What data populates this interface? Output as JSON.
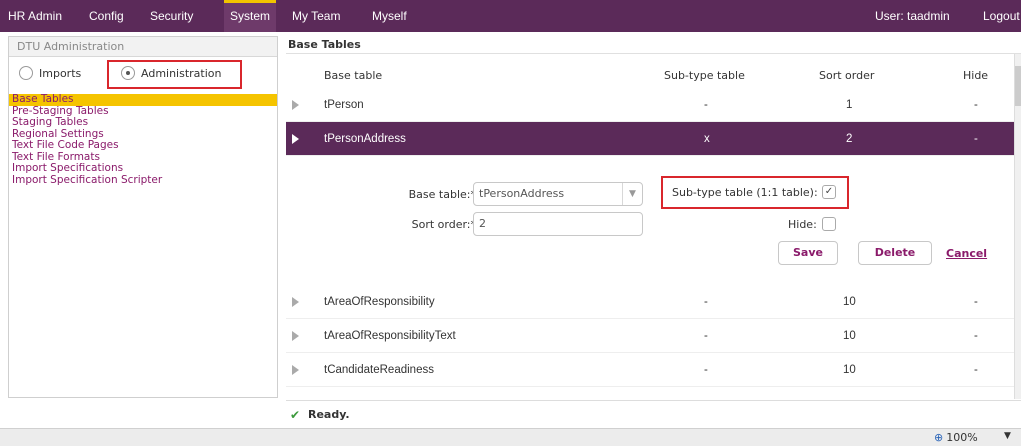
{
  "topnav": {
    "items": [
      "HR Admin",
      "Config",
      "Security",
      "System",
      "My Team",
      "Myself"
    ],
    "user": "User: taadmin",
    "logout": "Logout"
  },
  "left": {
    "panel_title": "DTU Administration",
    "radio_imports": "Imports",
    "radio_admin": "Administration",
    "menu": [
      "Base Tables",
      "Pre-Staging Tables",
      "Staging Tables",
      "Regional Settings",
      "Text File Code Pages",
      "Text File Formats",
      "Import Specifications",
      "Import Specification Scripter"
    ]
  },
  "main": {
    "title": "Base Tables",
    "columns": [
      "Base table",
      "Sub-type table",
      "Sort order",
      "Hide"
    ],
    "rows": [
      {
        "base": "tPerson",
        "subtype": "-",
        "sort": "1",
        "hide": "-"
      },
      {
        "base": "tPersonAddress",
        "subtype": "x",
        "sort": "2",
        "hide": "-"
      },
      {
        "base": "tAreaOfResponsibility",
        "subtype": "-",
        "sort": "10",
        "hide": "-"
      },
      {
        "base": "tAreaOfResponsibilityText",
        "subtype": "-",
        "sort": "10",
        "hide": "-"
      },
      {
        "base": "tCandidateReadiness",
        "subtype": "-",
        "sort": "10",
        "hide": "-"
      }
    ],
    "edit": {
      "base_label": "Base table:*",
      "base_value": "tPersonAddress",
      "sort_label": "Sort order:*",
      "sort_value": "2",
      "subtype_label": "Sub-type table (1:1 table):",
      "subtype_checked": "✓",
      "hide_label": "Hide:",
      "save": "Save",
      "delete": "Delete",
      "cancel": "Cancel"
    }
  },
  "status": {
    "text": "Ready."
  },
  "bottom": {
    "zoom": "100%"
  },
  "colors": {
    "nav": "#5b2a59",
    "accent": "#f5c400",
    "link": "#8a1a6a",
    "highlight": "#d9262c"
  }
}
